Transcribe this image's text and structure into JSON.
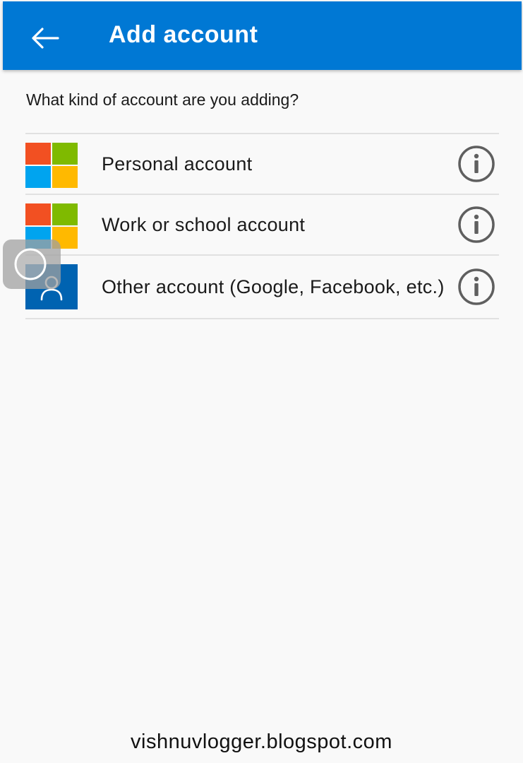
{
  "appbar": {
    "title": "Add account",
    "back_icon": "arrow-left-icon",
    "color": "#0078d4"
  },
  "prompt": "What kind of account are you adding?",
  "options": [
    {
      "label": "Personal account",
      "icon": "microsoft-logo-icon",
      "info_icon": "info-icon"
    },
    {
      "label": "Work or school account",
      "icon": "microsoft-logo-icon",
      "info_icon": "info-icon"
    },
    {
      "label": "Other account (Google, Facebook, etc.)",
      "icon": "person-icon",
      "info_icon": "info-icon"
    }
  ],
  "colors": {
    "ms_red": "#f25022",
    "ms_green": "#7fba00",
    "ms_blue": "#00a4ef",
    "ms_yellow": "#ffb900",
    "other_account_tile": "#0063b1"
  },
  "watermark": "vishnuvlogger.blogspot.com"
}
